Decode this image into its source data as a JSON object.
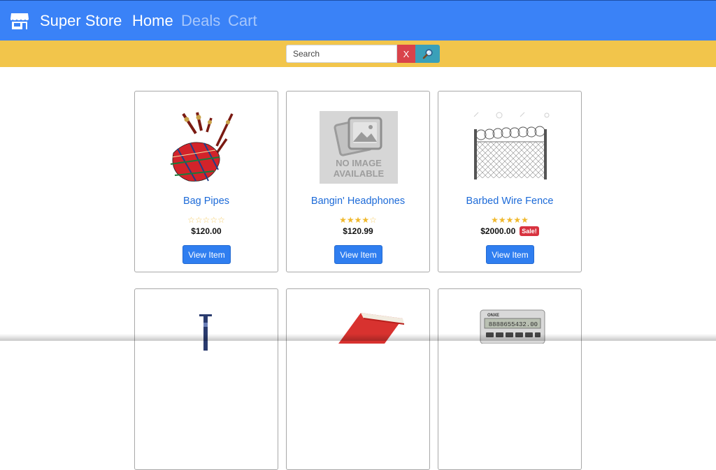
{
  "navbar": {
    "brand_icon": "store-icon",
    "brand": "Super Store",
    "links": [
      {
        "label": "Home",
        "active": true
      },
      {
        "label": "Deals",
        "active": false
      },
      {
        "label": "Cart",
        "active": false
      }
    ],
    "bg_color": "#3a82f7"
  },
  "search": {
    "placeholder": "Search",
    "value": "",
    "clear_label": "X",
    "search_icon": "magnifier-icon",
    "bar_color": "#f2c54b"
  },
  "products": [
    {
      "title": "Bag Pipes",
      "rating": 0,
      "max_rating": 5,
      "price": "$120.00",
      "sale": "",
      "button": "View Item",
      "image": "bagpipes-image"
    },
    {
      "title": "Bangin' Headphones",
      "rating": 4,
      "max_rating": 5,
      "price": "$120.99",
      "sale": "",
      "button": "View Item",
      "image": "no-image-placeholder",
      "placeholder_text_1": "NO IMAGE",
      "placeholder_text_2": "AVAILABLE"
    },
    {
      "title": "Barbed Wire Fence",
      "rating": 5,
      "max_rating": 5,
      "price": "$2000.00",
      "sale": "Sale!",
      "button": "View Item",
      "image": "barbed-wire-fence-image"
    },
    {
      "title": "",
      "image": "cane-image"
    },
    {
      "title": "",
      "image": "red-book-image"
    },
    {
      "title": "",
      "image": "calculator-image",
      "image_text_1": "ONXE",
      "image_text_2": "8888655432.00"
    }
  ]
}
